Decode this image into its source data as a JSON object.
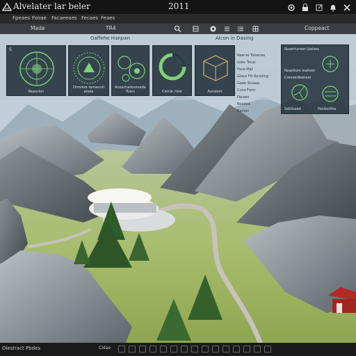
{
  "app": {
    "title": "Alvelater lar beler",
    "year": "2011"
  },
  "window_icons": [
    "settings-icon",
    "lock-icon",
    "share-icon",
    "bell-icon",
    "close-icon"
  ],
  "menu": {
    "items": [
      "Fpeaes",
      "Fooae",
      "Facaeeaes",
      "Fecaes",
      "Feaes"
    ]
  },
  "toolbar": {
    "left_label": "Mada",
    "center_label": "TR4",
    "right_label": "Coppeact"
  },
  "panels": {
    "left_section_title": "Gaffehe Hanpan",
    "right_section_title": "Alcon in Dasing",
    "cards": [
      {
        "corner": "S",
        "label": "Reaoclon"
      },
      {
        "corner": "",
        "label": "Drmrere remeunti aloda"
      },
      {
        "corner": "",
        "label": "Aceachadoomede Tuers"
      },
      {
        "corner": "",
        "label": "Cercle rrise"
      },
      {
        "corner": "",
        "label": "Ascalom"
      }
    ],
    "layers": [
      "Rearve Talsenes",
      "Gate Tocar",
      "Pace Mat",
      "Glace Ffr Rorating",
      "Gaee Stuaaa",
      "Cuns Fomr",
      "Pacaes",
      "Readed",
      "Rames"
    ],
    "right_panel": {
      "title": "Rusertuneer Lteises",
      "item1": "Reaeltom leaiteer",
      "item2": "Creeeedbatiaer",
      "foot1": "Sablissed",
      "foot2": "Peslestifes"
    }
  },
  "statusbar": {
    "label": "Dlestract Pbdes",
    "text": "Cldae"
  },
  "colors": {
    "accent_green": "#7fd17a",
    "panel_dark": "#26343e",
    "titlebar": "#141414"
  }
}
